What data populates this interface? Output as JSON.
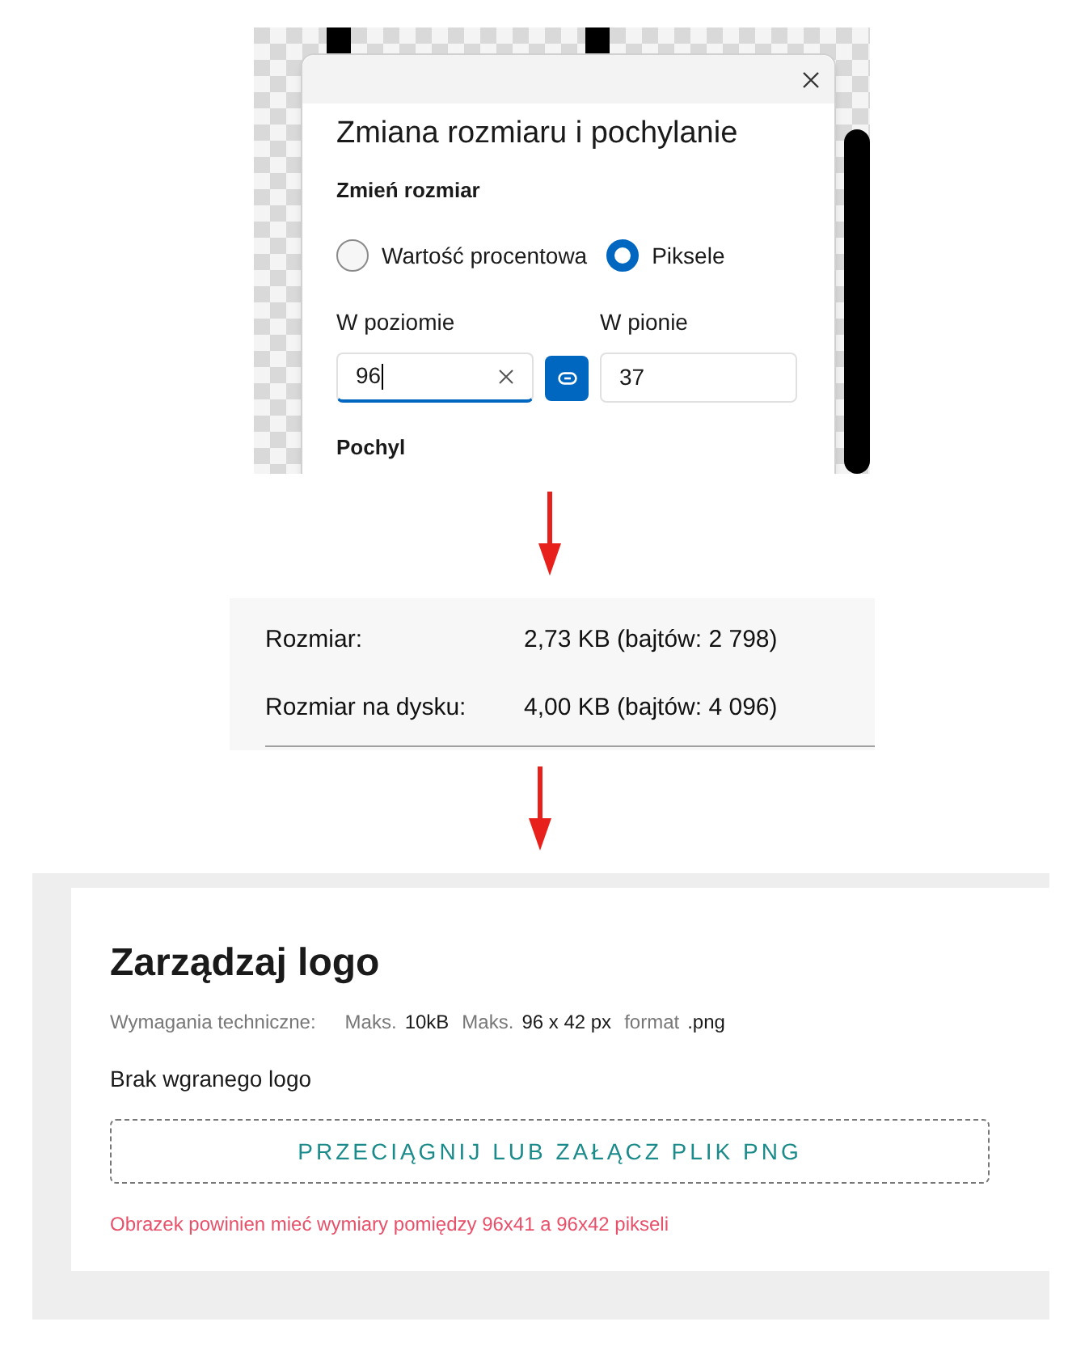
{
  "dialog": {
    "title": "Zmiana rozmiaru i pochylanie",
    "section": "Zmień rozmiar",
    "units": [
      {
        "label": "Wartość procentowa",
        "selected": false
      },
      {
        "label": "Piksele",
        "selected": true
      }
    ],
    "fields": [
      {
        "label": "W poziomie",
        "value": "96",
        "focused": true
      },
      {
        "label": "W pionie",
        "value": "37",
        "focused": false
      }
    ],
    "lock_aspect": {
      "on": true
    },
    "next_section": "Pochyl"
  },
  "properties": [
    {
      "label": "Rozmiar:",
      "value": "2,73 KB (bajtów: 2 798)"
    },
    {
      "label": "Rozmiar na dysku:",
      "value": "4,00 KB (bajtów: 4 096)"
    }
  ],
  "logo_panel": {
    "title": "Zarządzaj logo",
    "requirements_label": "Wymagania techniczne:",
    "requirements": [
      {
        "label": "Maks.",
        "value": "10kB"
      },
      {
        "label": "Maks.",
        "value": "96 x 42 px"
      },
      {
        "label": "format",
        "value": ".png"
      }
    ],
    "status": "Brak wgranego logo",
    "dropzone": "PRZECIĄGNIJ LUB ZAŁĄCZ PLIK PNG",
    "error": "Obrazek powinien mieć wymiary pomiędzy 96x41 a 96x42 pikseli"
  }
}
